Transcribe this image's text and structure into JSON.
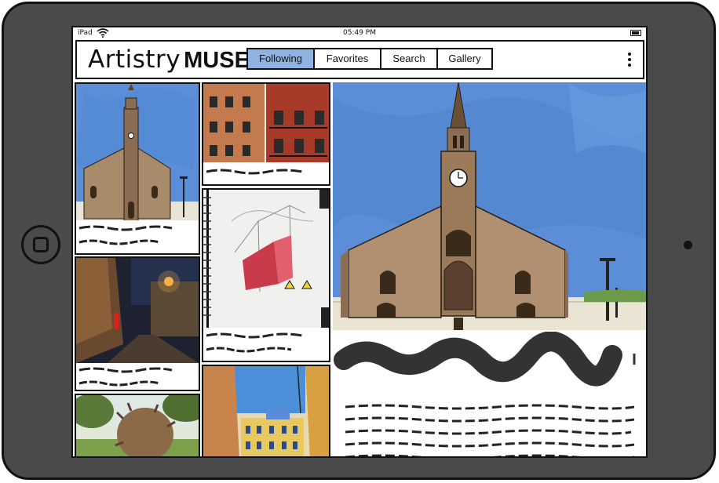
{
  "status_bar": {
    "device": "iPad",
    "time": "05:49 PM"
  },
  "app": {
    "logo_primary": "Artistry",
    "logo_secondary": "MUSE"
  },
  "nav": {
    "tabs": [
      {
        "label": "Following",
        "active": true
      },
      {
        "label": "Favorites",
        "active": false
      },
      {
        "label": "Search",
        "active": false
      },
      {
        "label": "Gallery",
        "active": false
      }
    ],
    "active_color": "#8fb2e0"
  },
  "feed": {
    "cards": [
      {
        "image": "church-watercolor-thumbnail"
      },
      {
        "image": "brick-building-sketch"
      },
      {
        "image": "night-street-photo"
      },
      {
        "image": "red-architecture-sketchbook"
      },
      {
        "image": "tree-sculpture-photo"
      },
      {
        "image": "colorful-street-painting"
      }
    ]
  },
  "detail": {
    "image": "church-watercolor-large",
    "sky_color": "#5b8ed6"
  },
  "colors": {
    "device_body": "#4a4a4a",
    "outline": "#111111",
    "scribble": "#222222"
  }
}
